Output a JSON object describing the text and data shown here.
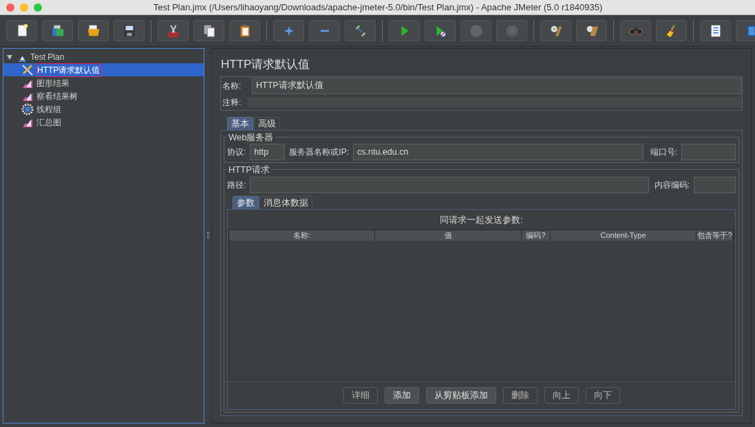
{
  "window": {
    "title": "Test Plan.jmx (/Users/lihaoyang/Downloads/apache-jmeter-5.0/bin/Test Plan.jmx) - Apache JMeter (5.0 r1840935)"
  },
  "toolbar": [
    {
      "kind": "new",
      "disabled": false
    },
    {
      "kind": "templates",
      "disabled": false
    },
    {
      "kind": "open",
      "disabled": false
    },
    {
      "kind": "save",
      "disabled": false
    },
    {
      "kind": "separator"
    },
    {
      "kind": "cut",
      "disabled": false
    },
    {
      "kind": "copy",
      "disabled": false
    },
    {
      "kind": "paste",
      "disabled": false
    },
    {
      "kind": "separator"
    },
    {
      "kind": "plus",
      "disabled": false
    },
    {
      "kind": "minus",
      "disabled": false
    },
    {
      "kind": "toggle",
      "disabled": false
    },
    {
      "kind": "separator"
    },
    {
      "kind": "start",
      "disabled": false
    },
    {
      "kind": "startnopause",
      "disabled": false
    },
    {
      "kind": "stop",
      "disabled": true
    },
    {
      "kind": "shutdown",
      "disabled": true
    },
    {
      "kind": "separator"
    },
    {
      "kind": "clear",
      "disabled": false
    },
    {
      "kind": "clearall",
      "disabled": false
    },
    {
      "kind": "separator"
    },
    {
      "kind": "search",
      "disabled": false
    },
    {
      "kind": "broom",
      "disabled": false
    },
    {
      "kind": "separator"
    },
    {
      "kind": "list",
      "disabled": false
    },
    {
      "kind": "help",
      "disabled": false
    }
  ],
  "tree": [
    {
      "label": "Test Plan",
      "kind": "plan",
      "selected": false,
      "expanded": true,
      "children": [
        {
          "label": "HTTP请求默认值",
          "kind": "config",
          "selected": true
        },
        {
          "label": "图形结果",
          "kind": "listener",
          "selected": false
        },
        {
          "label": "察看结果树",
          "kind": "listener",
          "selected": false
        },
        {
          "label": "线程组",
          "kind": "threadgroup",
          "selected": false
        },
        {
          "label": "汇总图",
          "kind": "listener",
          "selected": false
        }
      ]
    }
  ],
  "panel": {
    "title": "HTTP请求默认值",
    "name_label": "名称:",
    "name_value": "HTTP请求默认值",
    "comment_label": "注释:",
    "tabs": [
      {
        "label": "基本",
        "selected": true
      },
      {
        "label": "高级",
        "selected": false
      }
    ],
    "web_server": {
      "legend": "Web服务器",
      "protocol_label": "协议:",
      "protocol": "http",
      "server_label": "服务器名称或IP:",
      "server": "cs.ntu.edu.cn",
      "port_label": "端口号:"
    },
    "http_request": {
      "legend": "HTTP请求",
      "path_label": "路径:",
      "encoding_label": "内容编码:",
      "tabs": [
        {
          "label": "参数",
          "selected": true
        },
        {
          "label": "消息体数据",
          "selected": false
        }
      ],
      "table_title": "同请求一起发送参数:",
      "columns": [
        "名称:",
        "值",
        "编码?",
        "Content-Type",
        "包含等于?"
      ],
      "buttons": [
        {
          "label": "详细",
          "disabled": true
        },
        {
          "label": "添加",
          "disabled": false
        },
        {
          "label": "从剪贴板添加",
          "disabled": false
        },
        {
          "label": "删除",
          "disabled": true
        },
        {
          "label": "向上",
          "disabled": true
        },
        {
          "label": "向下",
          "disabled": true
        }
      ]
    }
  }
}
